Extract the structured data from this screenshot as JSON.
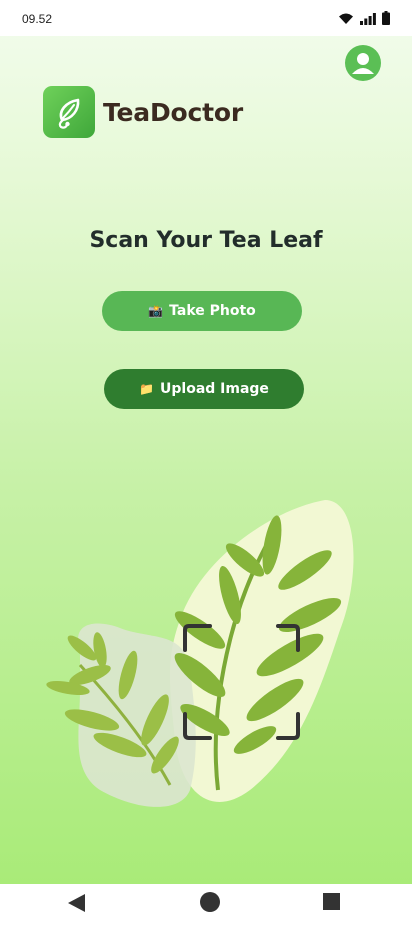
{
  "status": {
    "time": "09.52"
  },
  "app": {
    "name": "TeaDoctor"
  },
  "main": {
    "headline": "Scan Your Tea Leaf",
    "take_photo_icon": "📸",
    "take_photo_label": "Take Photo",
    "upload_icon": "📁",
    "upload_label": "Upload Image"
  },
  "icons": {
    "wifi": "wifi-icon",
    "signal": "signal-icon",
    "battery": "battery-icon",
    "profile": "profile-icon",
    "logo": "leaf-stethoscope-icon",
    "back": "back-icon",
    "home": "home-icon",
    "recent": "recent-apps-icon"
  },
  "colors": {
    "primary_green": "#58b755",
    "dark_green": "#2f7d2f",
    "logo_text": "#3b2a20",
    "headline": "#222d2b"
  }
}
